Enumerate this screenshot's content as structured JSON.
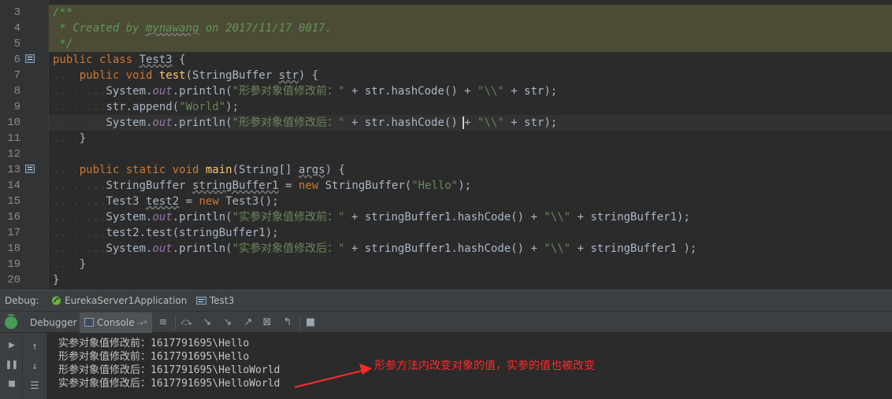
{
  "editor": {
    "gutter": [
      {
        "n": "3",
        "icon": false
      },
      {
        "n": "4",
        "icon": false
      },
      {
        "n": "5",
        "icon": false
      },
      {
        "n": "6",
        "icon": true
      },
      {
        "n": "7",
        "icon": false
      },
      {
        "n": "8",
        "icon": false
      },
      {
        "n": "9",
        "icon": false
      },
      {
        "n": "10",
        "icon": false
      },
      {
        "n": "11",
        "icon": false
      },
      {
        "n": "12",
        "icon": false
      },
      {
        "n": "13",
        "icon": true
      },
      {
        "n": "14",
        "icon": false
      },
      {
        "n": "15",
        "icon": false
      },
      {
        "n": "16",
        "icon": false
      },
      {
        "n": "17",
        "icon": false
      },
      {
        "n": "18",
        "icon": false
      },
      {
        "n": "19",
        "icon": false
      },
      {
        "n": "20",
        "icon": false
      }
    ],
    "lines": [
      {
        "style": "doc",
        "tokens": [
          [
            "cm",
            "/**"
          ]
        ]
      },
      {
        "style": "doc",
        "tokens": [
          [
            "cm",
            " * Created by "
          ],
          [
            "cm wavy",
            "mynawang"
          ],
          [
            "cm",
            " on 2017/11/17 0017."
          ]
        ]
      },
      {
        "style": "doc",
        "tokens": [
          [
            "cm",
            " */"
          ]
        ]
      },
      {
        "style": "",
        "tokens": [
          [
            "kw",
            "public class "
          ],
          [
            "wavy",
            "Test3"
          ],
          [
            "",
            " {"
          ]
        ]
      },
      {
        "style": "",
        "tokens": [
          [
            "indent",
            "...."
          ],
          [
            "kw",
            "public void "
          ],
          [
            "fn",
            "test"
          ],
          [
            "",
            "(StringBuffer "
          ],
          [
            "wavy",
            "str"
          ],
          [
            "",
            ") {"
          ]
        ]
      },
      {
        "style": "",
        "tokens": [
          [
            "indent",
            "........"
          ],
          [
            "",
            "System."
          ],
          [
            "sf",
            "out"
          ],
          [
            "",
            ".println("
          ],
          [
            "st",
            "\"形参对象值修改前：\""
          ],
          [
            "",
            " + str.hashCode() + "
          ],
          [
            "st",
            "\"\\\\\""
          ],
          [
            "",
            " + str);"
          ]
        ]
      },
      {
        "style": "",
        "tokens": [
          [
            "indent",
            "........"
          ],
          [
            "",
            "str.append("
          ],
          [
            "st",
            "\"World\""
          ],
          [
            "",
            ");"
          ]
        ]
      },
      {
        "style": "cur",
        "tokens": [
          [
            "indent",
            "........"
          ],
          [
            "",
            "System."
          ],
          [
            "sf",
            "out"
          ],
          [
            "",
            ".println("
          ],
          [
            "st",
            "\"形参对象值修改后：\""
          ],
          [
            "",
            " + str.hashCode() "
          ],
          [
            "caret",
            ""
          ],
          [
            "",
            "+ "
          ],
          [
            "st",
            "\"\\\\\""
          ],
          [
            "",
            " + str);"
          ]
        ]
      },
      {
        "style": "",
        "tokens": [
          [
            "indent",
            "...."
          ],
          [
            "",
            "}"
          ]
        ]
      },
      {
        "style": "",
        "tokens": []
      },
      {
        "style": "",
        "tokens": [
          [
            "indent",
            "...."
          ],
          [
            "kw",
            "public static void "
          ],
          [
            "fn",
            "main"
          ],
          [
            "",
            "(String[] "
          ],
          [
            "wavy",
            "args"
          ],
          [
            "",
            ") {"
          ]
        ]
      },
      {
        "style": "",
        "tokens": [
          [
            "indent",
            "........"
          ],
          [
            "",
            "StringBuffer "
          ],
          [
            "wavy",
            "stringBuffer1"
          ],
          [
            "",
            " = "
          ],
          [
            "kw",
            "new "
          ],
          [
            "",
            "StringBuffer("
          ],
          [
            "st",
            "\"Hello\""
          ],
          [
            "",
            ");"
          ]
        ]
      },
      {
        "style": "",
        "tokens": [
          [
            "indent",
            "........"
          ],
          [
            "",
            "Test3 "
          ],
          [
            "wavy",
            "test2"
          ],
          [
            "",
            " = "
          ],
          [
            "kw",
            "new "
          ],
          [
            "",
            "Test3();"
          ]
        ]
      },
      {
        "style": "",
        "tokens": [
          [
            "indent",
            "........"
          ],
          [
            "",
            "System."
          ],
          [
            "sf",
            "out"
          ],
          [
            "",
            ".println("
          ],
          [
            "st",
            "\"实参对象值修改前：\""
          ],
          [
            "",
            " + stringBuffer1.hashCode() + "
          ],
          [
            "st",
            "\"\\\\\""
          ],
          [
            "",
            " + stringBuffer1);"
          ]
        ]
      },
      {
        "style": "",
        "tokens": [
          [
            "indent",
            "........"
          ],
          [
            "",
            "test2.test(stringBuffer1);"
          ]
        ]
      },
      {
        "style": "",
        "tokens": [
          [
            "indent",
            "........"
          ],
          [
            "",
            "System."
          ],
          [
            "sf",
            "out"
          ],
          [
            "",
            ".println("
          ],
          [
            "st",
            "\"实参对象值修改后：\""
          ],
          [
            "",
            " + stringBuffer1.hashCode() + "
          ],
          [
            "st",
            "\"\\\\\""
          ],
          [
            "",
            " + stringBuffer1 );"
          ]
        ]
      },
      {
        "style": "",
        "tokens": [
          [
            "indent",
            "...."
          ],
          [
            "",
            "}"
          ]
        ]
      },
      {
        "style": "",
        "tokens": [
          [
            "",
            "}"
          ]
        ]
      }
    ]
  },
  "debug": {
    "label": "Debug:",
    "tabs": [
      {
        "label": "EurekaServer1Application",
        "icon": "spring-boot-icon"
      },
      {
        "label": "Test3",
        "icon": "class-config-icon"
      }
    ]
  },
  "toolbar": {
    "debugger_label": "Debugger",
    "console_label": "Console",
    "console_suffix": "→*",
    "buttons": [
      "show-execution-point-icon",
      "step-over-icon",
      "step-into-icon",
      "force-step-into-icon",
      "step-out-icon",
      "drop-frame-icon",
      "run-to-cursor-icon",
      "evaluate-expression-icon",
      "trace-icon"
    ]
  },
  "console": {
    "lines": [
      "实参对象值修改前：1617791695\\Hello",
      "形参对象值修改前：1617791695\\Hello",
      "形参对象值修改后：1617791695\\HelloWorld",
      "实参对象值修改后：1617791695\\HelloWorld"
    ],
    "annotation": "形参方法内改变对象的值，实参的值也被改变",
    "annotation_color": "#ff2a2a"
  },
  "colors": {
    "keyword": "#cc7832",
    "function": "#ffc66d",
    "string": "#6a8759",
    "comment": "#629755",
    "static_field": "#9876aa",
    "text": "#a9b7c6"
  }
}
